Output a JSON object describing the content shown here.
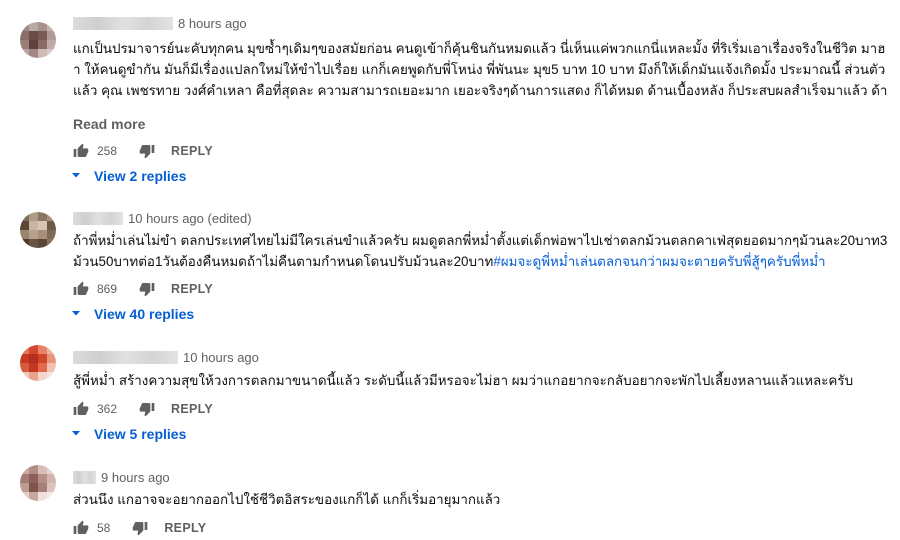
{
  "colors": {
    "link": "#065fd4",
    "meta": "#606060",
    "text": "#0f0f0f"
  },
  "comments": [
    {
      "time": "8 hours ago",
      "text": "แกเป็นปรมาจารย์นะคับทุกคน มุขซ้ำๆเดิมๆของสมัยก่อน คนดูเข้าก็คุ้นชินกันหมดแล้ว นี่เห็นแค่พวกแกนี่แหละมั้ง ที่ริเริ่มเอาเรื่องจริงในชีวิต มาฮา ให้คนดูขำกัน มันก็มีเรื่องแปลกใหม่ให้ขำไปเรื่อย แกก็เคยพูดกับพี่โหน่ง พี่พันนะ มุข5 บาท 10 บาท มึงก็ให้เด็กมันแจ้งเกิดมั้ง ประมาณนี้ ส่วนตัวแล้ว คุณ เพชรทาย วงศ์คำเหลา คือที่สุดละ ความสามารถเยอะมาก เยอะจริงๆด้านการแสดง ก็ได้หมด ด้านเบื้องหลัง ก็ประสบผลสำเร็จมาแล้ว ด้านการขับร้อง แกก็โด่งดังมาแล้ว ทำอาหารก็อร่อย ระดับล้าน ด้านการปกครองคน แกก็ทำได้น่าขึ้นชมมากๆๆ ผู้มีพระคุณเอย คนในครอบครัวเอย พี่น้อง มิตรสหายเอย ลูกน้องเอย ใครก็รักพี่...",
      "read_more": "Read more",
      "likes": "258",
      "reply_label": "REPLY",
      "replies_label": "View 2 replies"
    },
    {
      "time": "10 hours ago (edited)",
      "text": "ถ้าพี่หม่ำเล่นไม่ขำ ตลกประเทศไทยไม่มีใครเล่นขำแล้วครับ ผมดูตลกพี่หม่ำตั้งแต่เด็กพ่อพาไปเช่าตลกม้วนตลกคาเฟ่สุดยอดมากๆม้วนละ20บาท3ม้วน50บาทต่อ1วันต้องคืนหมดถ้าไม่คืนตามกำหนดโดนปรับม้วนละ20บาท",
      "hashtag": "#ผมจะดูพี่หม่ำเล่นตลกจนกว่าผมจะตายครับพี่สู้ๆครับพี่หม่ำ",
      "likes": "869",
      "reply_label": "REPLY",
      "replies_label": "View 40 replies"
    },
    {
      "time": "10 hours ago",
      "text": "สู้พี่หม่ำ สร้างความสุขให้วงการตลกมาขนาดนี้แล้ว ระดับนี้แล้วมีหรอจะไม่ฮา ผมว่าแกอยากจะกลับอยากจะพักไปเลี้ยงหลานแล้วแหละครับ",
      "likes": "362",
      "reply_label": "REPLY",
      "replies_label": "View 5 replies"
    },
    {
      "time": "9 hours ago",
      "text": "ส่วนนึง แกอาจจะอยากออกไปใช้ชีวิตอิสระของแกก็ได้ แกก็เริ่มอายุมากแล้ว",
      "likes": "58",
      "reply_label": "REPLY"
    }
  ]
}
